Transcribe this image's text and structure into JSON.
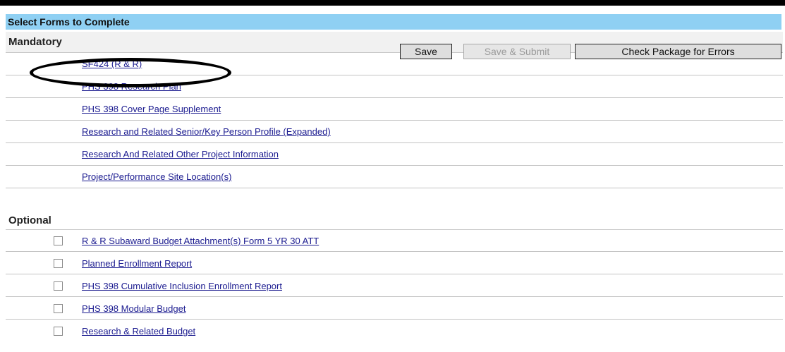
{
  "header": {
    "title": "Select Forms to Complete"
  },
  "mandatory": {
    "label": "Mandatory",
    "forms": [
      "SF424 (R & R)",
      "PHS 398 Research Plan",
      "PHS 398 Cover Page Supplement",
      "Research and Related Senior/Key Person Profile (Expanded)",
      "Research And Related Other Project Information",
      "Project/Performance Site Location(s)"
    ]
  },
  "toolbar": {
    "save_label": "Save",
    "save_submit_label": "Save & Submit",
    "check_label": "Check Package for Errors"
  },
  "optional": {
    "label": "Optional",
    "forms": [
      "R & R Subaward Budget Attachment(s) Form 5 YR 30 ATT",
      "Planned Enrollment Report",
      "PHS 398 Cumulative Inclusion Enrollment Report",
      "PHS 398 Modular Budget",
      "Research & Related Budget"
    ]
  }
}
